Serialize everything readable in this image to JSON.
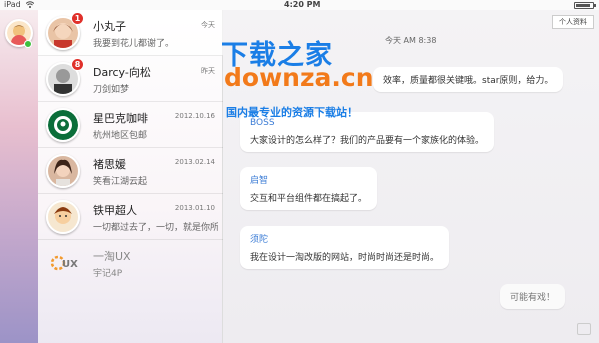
{
  "status_bar": {
    "device": "iPad",
    "time": "4:20 PM",
    "battery_level": 0.85
  },
  "contacts": [
    {
      "name": "小丸子",
      "preview": "我要到花儿都谢了。",
      "date": "今天",
      "unread": "1",
      "avatar": "girl-avatar"
    },
    {
      "name": "Darcy-向松",
      "preview": "刀剑如梦",
      "date": "昨天",
      "unread": "8",
      "avatar": "bw-avatar"
    },
    {
      "name": "星巴克咖啡",
      "preview": "杭州地区包邮",
      "date": "2012.10.16",
      "avatar": "starbucks-logo"
    },
    {
      "name": "褚思媛",
      "preview": "笑看江湖云起",
      "date": "2013.02.14",
      "avatar": "woman-avatar"
    },
    {
      "name": "铁甲超人",
      "preview": "一切都过去了，一切，就是你所看...",
      "date": "2013.01.10",
      "avatar": "cartoon-avatar"
    },
    {
      "name": "一淘UX",
      "preview": "宇记4P",
      "date": "",
      "avatar": "ux-logo"
    }
  ],
  "chat": {
    "profile_button": "个人资料",
    "timestamp": "今天  AM 8:38",
    "messages": [
      {
        "sender": "",
        "text": "效率，质量都很关键哦。star原则，给力。"
      },
      {
        "sender": "BOSS",
        "text": "大家设计的怎么样了？我们的产品要有一个家族化的体验。"
      },
      {
        "sender": "启智",
        "text": "交互和平台组件都在搞起了。"
      },
      {
        "sender": "须陀",
        "text": "我在设计一淘改版的网站，时尚时尚还是时尚。"
      },
      {
        "sender": "",
        "text": "可能有戏！",
        "mine": true
      }
    ]
  },
  "watermark": {
    "title": "下载之家",
    "domain": "downza.cn",
    "slogan": "国内最专业的资源下载站！"
  },
  "colors": {
    "accent": "#3a7bd5",
    "badge": "#e0302a",
    "watermark_blue": "#1a7ee6",
    "watermark_orange": "#f27a1a"
  }
}
